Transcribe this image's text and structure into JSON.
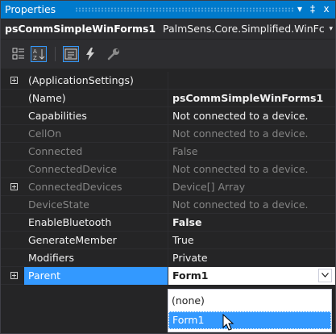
{
  "panel": {
    "title": "Properties",
    "buttons": {
      "dropdown": "▾",
      "pin": "‡",
      "close": "x"
    }
  },
  "selector": {
    "object_name": "psCommSimpleWinForms1",
    "object_type": "PalmSens.Core.Simplified.WinFc",
    "arrow": "▾"
  },
  "toolbar": {
    "tools": [
      {
        "name": "categorized-view",
        "icon": "categorized-icon",
        "active": false
      },
      {
        "name": "alphabetical-view",
        "icon": "alphabetical-icon",
        "active": true
      },
      {
        "name": "properties-view",
        "icon": "properties-icon",
        "active": true
      },
      {
        "name": "events-view",
        "icon": "lightning-icon",
        "active": false
      },
      {
        "name": "property-pages",
        "icon": "wrench-icon",
        "active": false
      }
    ]
  },
  "properties": [
    {
      "name": "(ApplicationSettings)",
      "value": "",
      "expandable": true,
      "readonly": false,
      "bold_value": false
    },
    {
      "name": "(Name)",
      "value": "psCommSimpleWinForms1",
      "expandable": false,
      "readonly": false,
      "bold_value": true
    },
    {
      "name": "Capabilities",
      "value": "Not connected to a device.",
      "expandable": false,
      "readonly": false,
      "bold_value": false
    },
    {
      "name": "CellOn",
      "value": "Not connected to a device.",
      "expandable": false,
      "readonly": true,
      "bold_value": false
    },
    {
      "name": "Connected",
      "value": "False",
      "expandable": false,
      "readonly": true,
      "bold_value": false
    },
    {
      "name": "ConnectedDevice",
      "value": "Not connected to a device.",
      "expandable": false,
      "readonly": true,
      "bold_value": false
    },
    {
      "name": "ConnectedDevices",
      "value": "Device[] Array",
      "expandable": true,
      "readonly": true,
      "bold_value": false
    },
    {
      "name": "DeviceState",
      "value": "Not connected to a device.",
      "expandable": false,
      "readonly": true,
      "bold_value": false
    },
    {
      "name": "EnableBluetooth",
      "value": "False",
      "expandable": false,
      "readonly": false,
      "bold_value": true
    },
    {
      "name": "GenerateMember",
      "value": "True",
      "expandable": false,
      "readonly": false,
      "bold_value": false
    },
    {
      "name": "Modifiers",
      "value": "Private",
      "expandable": false,
      "readonly": false,
      "bold_value": false
    },
    {
      "name": "Parent",
      "value": "Form1",
      "expandable": true,
      "readonly": false,
      "bold_value": true
    }
  ],
  "dropdown": {
    "options": [
      "(none)",
      "Form1"
    ],
    "selected": "Form1"
  },
  "colors": {
    "accent": "#007acc",
    "selection": "#3399ff",
    "background": "#252526",
    "text": "#f1f1f1",
    "muted_text": "#858585"
  }
}
